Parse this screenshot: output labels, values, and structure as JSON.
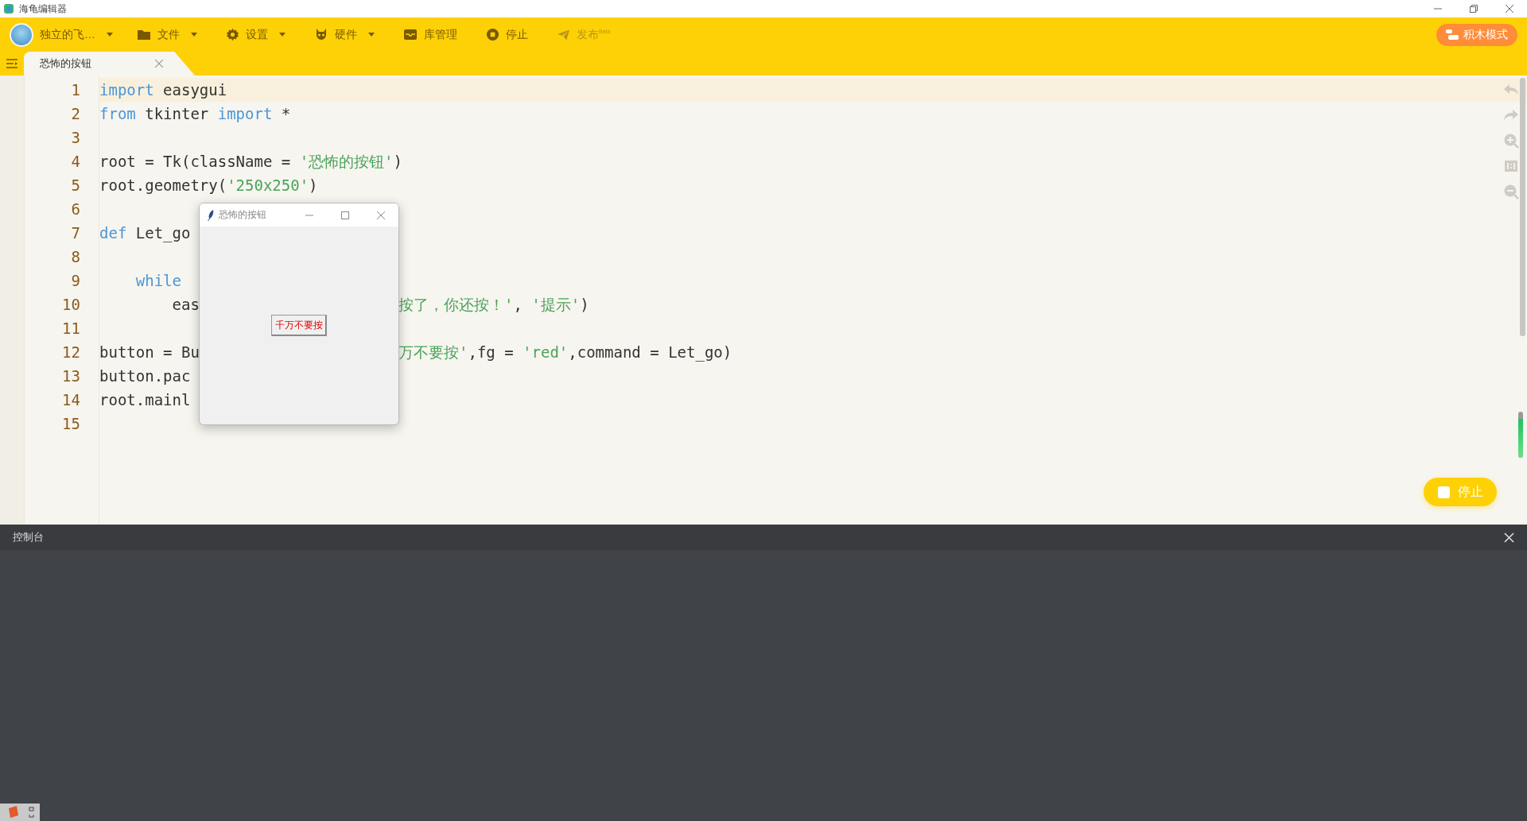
{
  "app_title": "海龟编辑器",
  "toolbar": {
    "user": {
      "name": "独立的飞…",
      "has_menu": true
    },
    "items": [
      {
        "label": "文件",
        "has_menu": true,
        "disabled": false
      },
      {
        "label": "设置",
        "has_menu": true,
        "disabled": false
      },
      {
        "label": "硬件",
        "has_menu": true,
        "disabled": false
      },
      {
        "label": "库管理",
        "has_menu": false,
        "disabled": false
      },
      {
        "label": "停止",
        "has_menu": false,
        "disabled": false
      },
      {
        "label": "发布",
        "badge": "Beta",
        "has_menu": false,
        "disabled": true
      }
    ],
    "mode_button": "积木模式"
  },
  "tabs": [
    {
      "label": "恐怖的按钮",
      "selected": true
    }
  ],
  "code_lines": [
    {
      "number": "1",
      "current": true,
      "tokens": [
        {
          "kind": "keyword",
          "text": "import"
        },
        {
          "kind": "plain",
          "text": " easygui"
        }
      ]
    },
    {
      "number": "2",
      "current": false,
      "tokens": [
        {
          "kind": "keyword",
          "text": "from"
        },
        {
          "kind": "plain",
          "text": " tkinter "
        },
        {
          "kind": "keyword",
          "text": "import"
        },
        {
          "kind": "plain",
          "text": " *"
        }
      ]
    },
    {
      "number": "3",
      "current": false
    },
    {
      "number": "4",
      "current": false,
      "tokens": [
        {
          "kind": "plain",
          "text": "root = Tk(className = "
        },
        {
          "kind": "string",
          "text": "'恐怖的按钮'"
        },
        {
          "kind": "plain",
          "text": ")"
        }
      ]
    },
    {
      "number": "5",
      "current": false,
      "tokens": [
        {
          "kind": "plain",
          "text": "root.geometry("
        },
        {
          "kind": "string",
          "text": "'250x250'"
        },
        {
          "kind": "plain",
          "text": ")"
        }
      ]
    },
    {
      "number": "6",
      "current": false
    },
    {
      "number": "7",
      "current": false,
      "tokens": [
        {
          "kind": "keyword",
          "text": "def"
        },
        {
          "kind": "plain",
          "text": " Let_go"
        }
      ]
    },
    {
      "number": "8",
      "current": false
    },
    {
      "number": "9",
      "current": false,
      "tokens": [
        {
          "kind": "keyword",
          "text": "    while"
        }
      ]
    },
    {
      "number": "10",
      "current": false,
      "tokens": [
        {
          "kind": "plain",
          "text": "        eas"
        }
      ],
      "after_window": [
        {
          "kind": "string",
          "text": "按了，你还按！'"
        },
        {
          "kind": "plain",
          "text": ", "
        },
        {
          "kind": "string",
          "text": "'提示'"
        },
        {
          "kind": "plain",
          "text": ")"
        }
      ]
    },
    {
      "number": "11",
      "current": false
    },
    {
      "number": "12",
      "current": false,
      "tokens": [
        {
          "kind": "plain",
          "text": "button = Bu"
        }
      ],
      "after_window": [
        {
          "kind": "string",
          "text": "万不要按'"
        },
        {
          "kind": "plain",
          "text": ",fg = "
        },
        {
          "kind": "string",
          "text": "'red'"
        },
        {
          "kind": "plain",
          "text": ",command = Let_go)"
        }
      ]
    },
    {
      "number": "13",
      "current": false,
      "tokens": [
        {
          "kind": "plain",
          "text": "button.pac"
        }
      ]
    },
    {
      "number": "14",
      "current": false,
      "tokens": [
        {
          "kind": "plain",
          "text": "root.mainl"
        }
      ]
    },
    {
      "number": "15",
      "current": false
    }
  ],
  "run_meter": {
    "level": 0.85
  },
  "stop_button": "停止",
  "tk_window": {
    "title": "恐怖的按钮",
    "button": "千万不要按"
  },
  "console": {
    "title": "控制台"
  }
}
